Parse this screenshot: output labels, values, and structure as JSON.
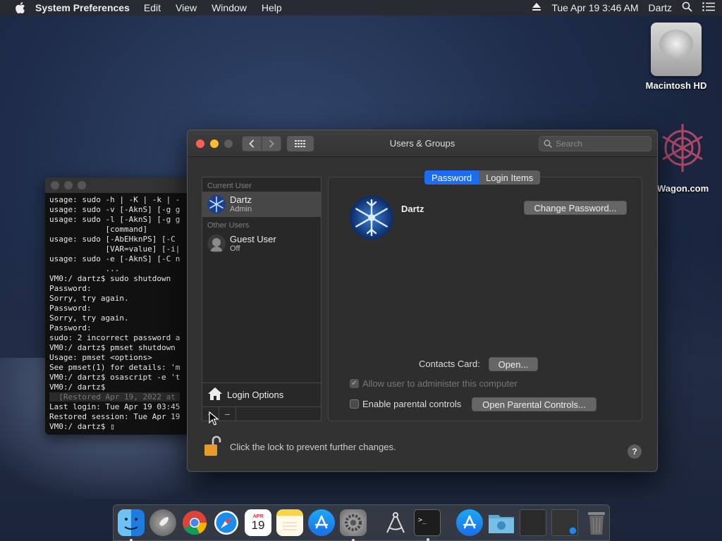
{
  "menubar": {
    "app_name": "System Preferences",
    "menus": [
      "Edit",
      "View",
      "Window",
      "Help"
    ],
    "clock": "Tue Apr 19  3:46 AM",
    "user": "Dartz"
  },
  "desktop": {
    "drive_label": "Macintosh HD",
    "partial_label": "Wagon.com"
  },
  "terminal": {
    "lines": [
      "usage: sudo -h | -K | -k | -",
      "usage: sudo -v [-AknS] [-g g",
      "usage: sudo -l [-AknS] [-g g",
      "            [command]",
      "usage: sudo [-AbEHknPS] [-C ",
      "            [VAR=value] [-i|",
      "usage: sudo -e [-AknS] [-C n",
      "            ...",
      "VM0:/ dartz$ sudo shutdown",
      "Password:",
      "Sorry, try again.",
      "Password:",
      "Sorry, try again.",
      "Password:",
      "sudo: 2 incorrect password a",
      "VM0:/ dartz$ pmset shutdown",
      "Usage: pmset <options>",
      "See pmset(1) for details: 'm",
      "VM0:/ dartz$ osascript -e 't",
      "VM0:/ dartz$"
    ],
    "restored": "  [Restored Apr 19, 2022 at ",
    "tail": [
      "Last login: Tue Apr 19 03:45",
      "Restored session: Tue Apr 19",
      "VM0:/ dartz$ ▯"
    ]
  },
  "window": {
    "title": "Users & Groups",
    "search_placeholder": "Search",
    "sidebar": {
      "current_user_header": "Current User",
      "current_user": {
        "name": "Dartz",
        "role": "Admin"
      },
      "other_users_header": "Other Users",
      "other_user": {
        "name": "Guest User",
        "role": "Off"
      },
      "login_options": "Login Options",
      "add": "+",
      "remove": "−"
    },
    "tabs": [
      "Password",
      "Login Items"
    ],
    "user_name": "Dartz",
    "change_password": "Change Password...",
    "contacts_label": "Contacts Card:",
    "contacts_open": "Open...",
    "allow_admin": "Allow user to administer this computer",
    "parental": "Enable parental controls",
    "open_parental": "Open Parental Controls...",
    "lock_text": "Click the lock to prevent further changes.",
    "help": "?"
  },
  "dock": {
    "calendar_month": "APR",
    "calendar_day": "19"
  },
  "colors": {
    "accent": "#1b6ef3",
    "close": "#ff5f57",
    "minimize": "#febc2e"
  }
}
